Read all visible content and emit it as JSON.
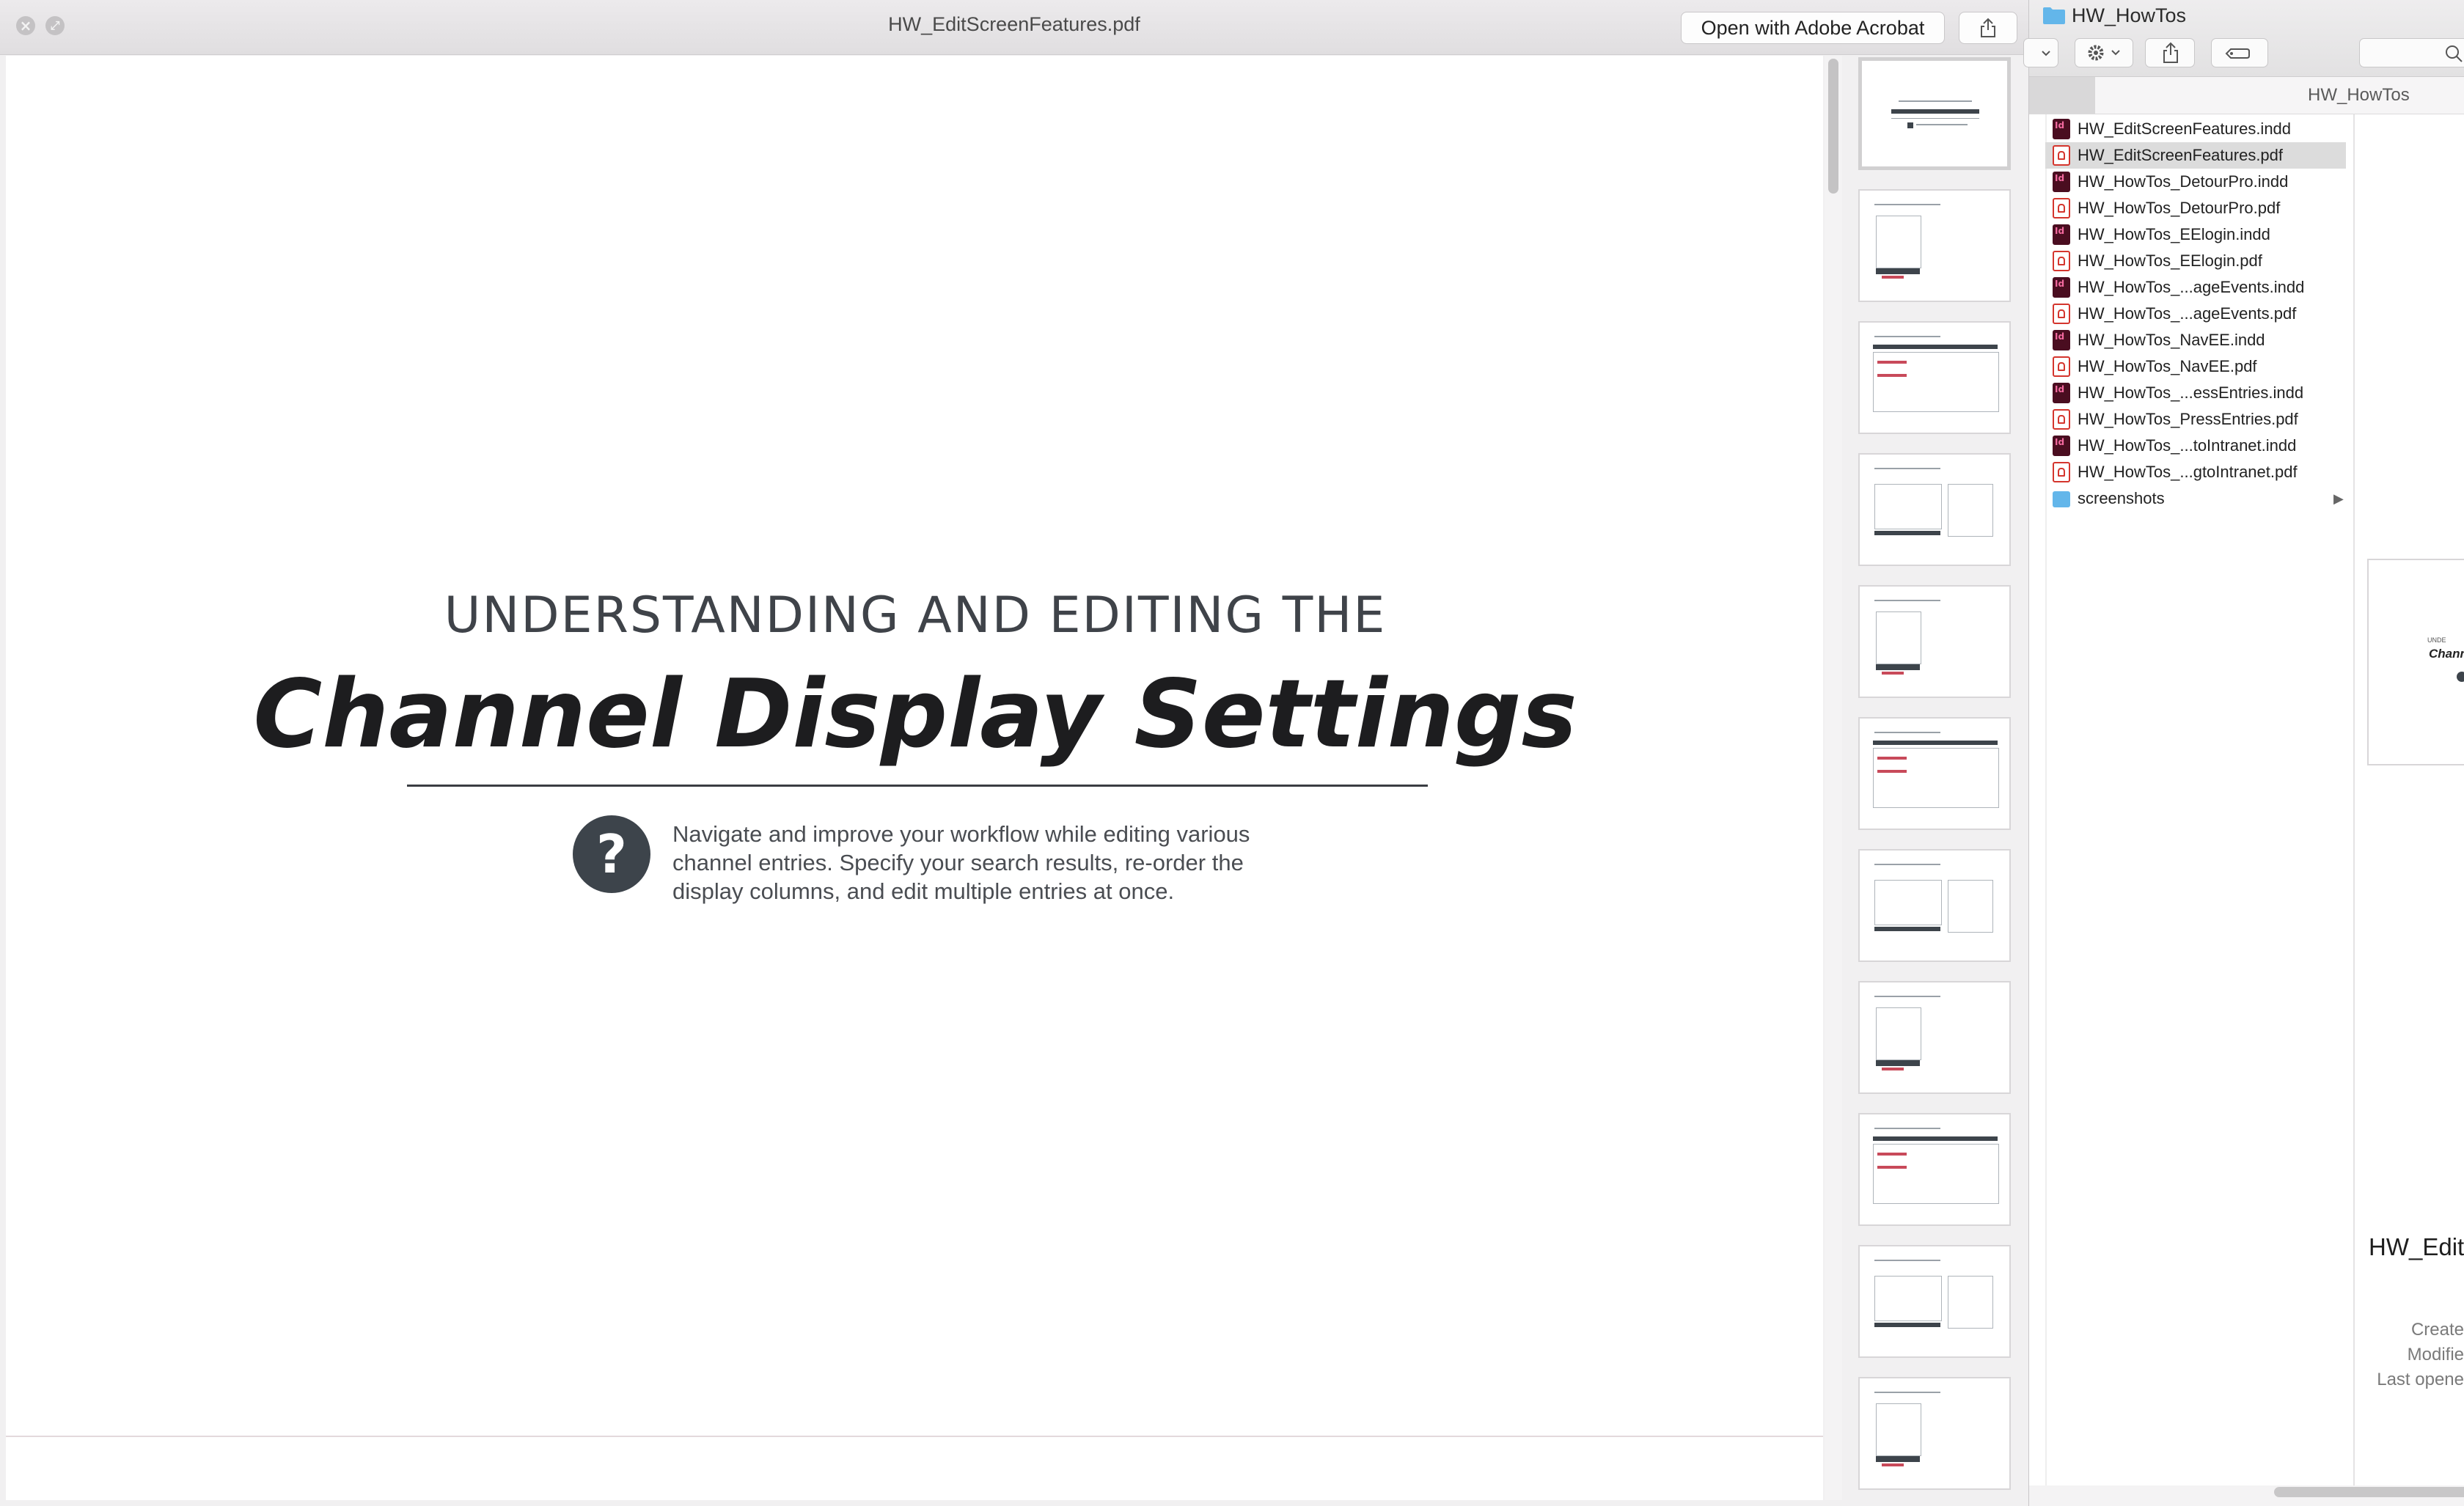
{
  "quicklook": {
    "title": "HW_EditScreenFeatures.pdf",
    "open_button": "Open with Adobe Acrobat",
    "buttons": {
      "close": "×",
      "fullscreen": "⤢"
    }
  },
  "document": {
    "subtitle": "UNDERSTANDING AND EDITING THE",
    "title": "Channel Display Settings",
    "help_glyph": "?",
    "intro": "Navigate and improve your workflow while editing various channel entries. Specify your search results, re-order the display columns, and edit multiple entries at once."
  },
  "thumbnails": {
    "count": 11,
    "selected_index": 0
  },
  "finder": {
    "title": "HW_HowTos",
    "column_header": "HW_HowTos",
    "files": [
      {
        "name": "HW_EditScreenFeatures.indd",
        "type": "indd"
      },
      {
        "name": "HW_EditScreenFeatures.pdf",
        "type": "pdf",
        "selected": true
      },
      {
        "name": "HW_HowTos_DetourPro.indd",
        "type": "indd"
      },
      {
        "name": "HW_HowTos_DetourPro.pdf",
        "type": "pdf"
      },
      {
        "name": "HW_HowTos_EElogin.indd",
        "type": "indd"
      },
      {
        "name": "HW_HowTos_EElogin.pdf",
        "type": "pdf"
      },
      {
        "name": "HW_HowTos_...ageEvents.indd",
        "type": "indd"
      },
      {
        "name": "HW_HowTos_...ageEvents.pdf",
        "type": "pdf"
      },
      {
        "name": "HW_HowTos_NavEE.indd",
        "type": "indd"
      },
      {
        "name": "HW_HowTos_NavEE.pdf",
        "type": "pdf"
      },
      {
        "name": "HW_HowTos_...essEntries.indd",
        "type": "indd"
      },
      {
        "name": "HW_HowTos_PressEntries.pdf",
        "type": "pdf"
      },
      {
        "name": "HW_HowTos_...toIntranet.indd",
        "type": "indd"
      },
      {
        "name": "HW_HowTos_...gtoIntranet.pdf",
        "type": "pdf"
      },
      {
        "name": "screenshots",
        "type": "folder"
      }
    ],
    "preview": {
      "name": "HW_Edit",
      "meta_labels": [
        "Create",
        "Modifie",
        "Last opene"
      ],
      "thumb_text_1": "UNDE",
      "thumb_text_2": "Chann"
    },
    "folder_arrow": "▶"
  },
  "colors": {
    "help_icon": "#3d444b",
    "selection": "#dcdcdc",
    "folder": "#63b6ea",
    "indd_icon": "#4a0d20",
    "pdf_icon": "#d4352d"
  }
}
